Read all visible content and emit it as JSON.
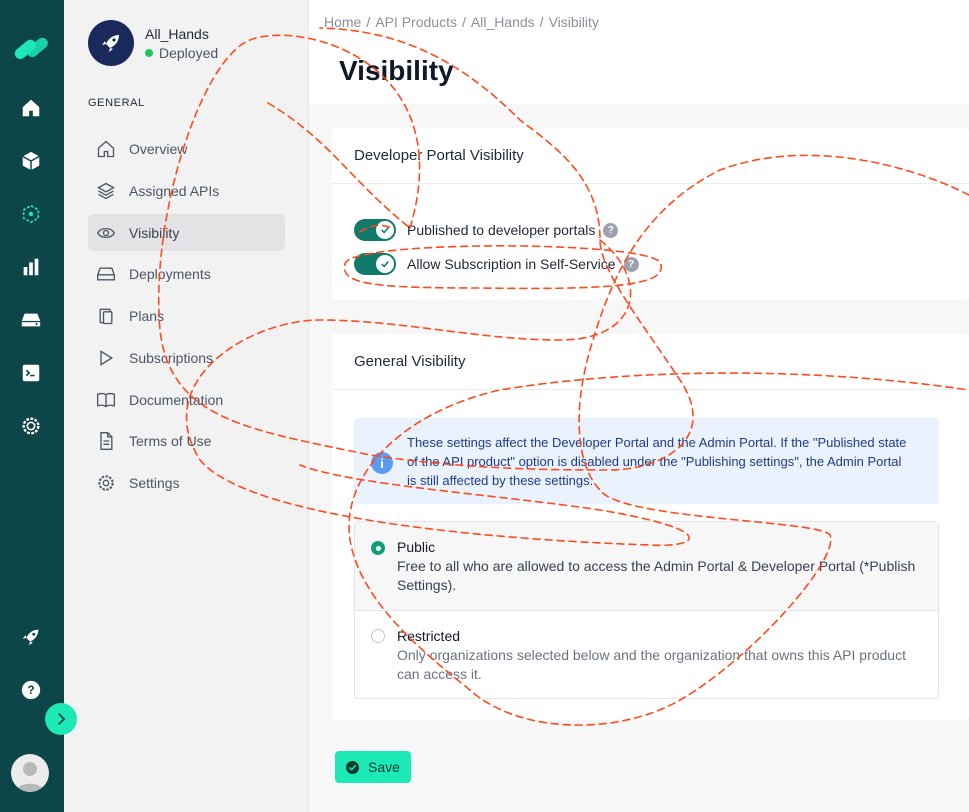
{
  "colors": {
    "rail_bg": "#0d4648",
    "accent": "#1de9b6",
    "toggle_on": "#117a6b",
    "status_green": "#22c55e",
    "info_bg": "#eaf2fd",
    "info_text": "#1e3a8a",
    "annotation": "#ff4a1c"
  },
  "rail": {
    "icons": [
      "brand-logo-icon",
      "home-icon",
      "cube-icon",
      "api-product-icon",
      "analytics-icon",
      "server-icon",
      "terminal-icon",
      "settings-gear-icon",
      "rocket-icon",
      "help-icon"
    ],
    "expand_icon": "chevron-right-icon",
    "avatar_icon": "user-avatar-icon"
  },
  "product": {
    "name": "All_Hands",
    "status": "Deployed"
  },
  "subnav": {
    "section_label": "GENERAL",
    "items": [
      {
        "label": "Overview",
        "icon": "home-outline-icon"
      },
      {
        "label": "Assigned APIs",
        "icon": "layers-icon"
      },
      {
        "label": "Visibility",
        "icon": "eye-icon",
        "active": true
      },
      {
        "label": "Deployments",
        "icon": "drive-icon"
      },
      {
        "label": "Plans",
        "icon": "clipboard-icon"
      },
      {
        "label": "Subscriptions",
        "icon": "play-icon"
      },
      {
        "label": "Documentation",
        "icon": "book-icon"
      },
      {
        "label": "Terms of Use",
        "icon": "document-icon"
      },
      {
        "label": "Settings",
        "icon": "gear-icon"
      }
    ]
  },
  "breadcrumb": [
    "Home",
    "API Products",
    "All_Hands",
    "Visibility"
  ],
  "page": {
    "title": "Visibility"
  },
  "dev_portal_card": {
    "title": "Developer Portal Visibility",
    "toggles": [
      {
        "label": "Published to developer portals",
        "on": true
      },
      {
        "label": "Allow Subscription in Self-Service",
        "on": true
      }
    ]
  },
  "general_card": {
    "title": "General Visibility",
    "info": "These settings affect the Developer Portal and the Admin Portal. If the \"Published state of the API product\" option is disabled under the \"Publishing settings\", the Admin Portal is still affected by these settings.",
    "options": [
      {
        "title": "Public",
        "description": "Free to all who are allowed to access the Admin Portal & Developer Portal (*Publish Settings).",
        "selected": true
      },
      {
        "title": "Restricted",
        "description": "Only organizations selected below and the organization that owns this API product can access it.",
        "selected": false
      }
    ]
  },
  "save_label": "Save"
}
